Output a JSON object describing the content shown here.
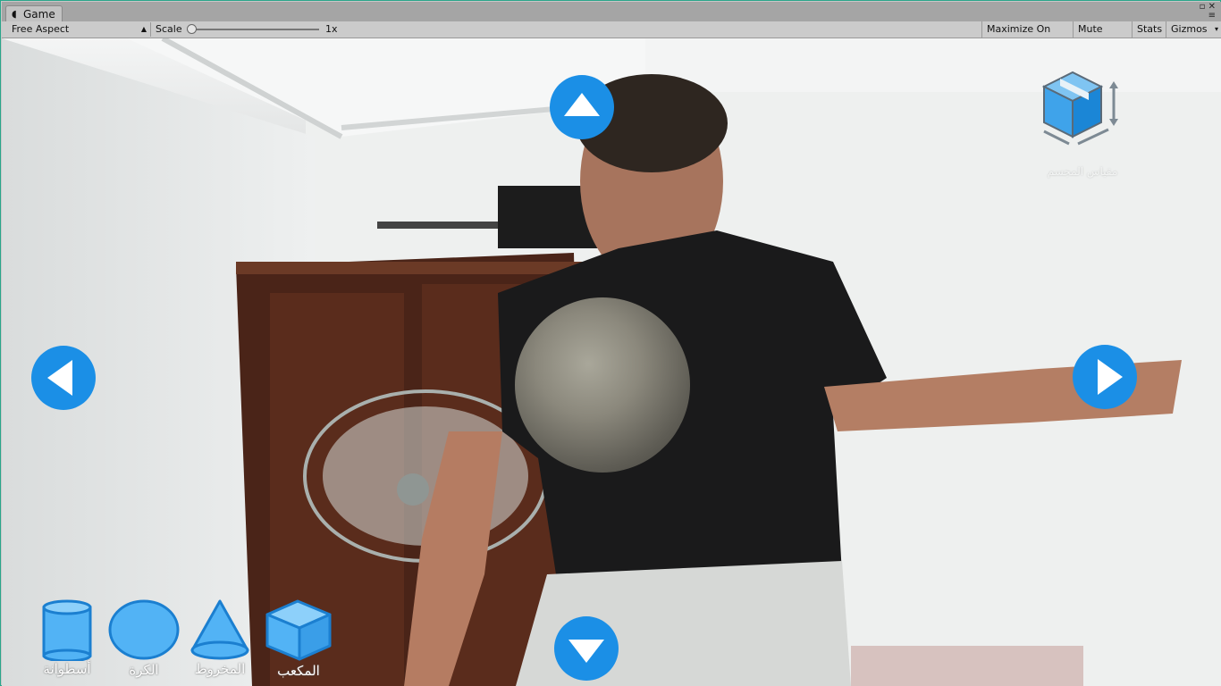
{
  "window": {
    "tab_title": "Game",
    "tab_icon": "game-icon"
  },
  "toolbar": {
    "aspect": "Free Aspect",
    "scale_label": "Scale",
    "scale_value": "1x",
    "scale_fraction": 0.02,
    "maximize_on_play": "Maximize On Play",
    "mute_audio": "Mute Audio",
    "stats": "Stats",
    "gizmos": "Gizmos"
  },
  "game": {
    "nav": {
      "up": "arrow-up-icon",
      "down": "arrow-down-icon",
      "left": "arrow-left-icon",
      "right": "arrow-right-icon"
    },
    "scale_tool": {
      "icon": "box-resize-icon",
      "label": "مقياس المجسم"
    },
    "shapes": [
      {
        "label": "أسطوانة",
        "icon": "cylinder-icon"
      },
      {
        "label": "الكرة",
        "icon": "sphere-icon"
      },
      {
        "label": "المخروط",
        "icon": "cone-icon"
      },
      {
        "label": "المكعب",
        "icon": "cube-icon"
      }
    ],
    "accent_color": "#1b8fe6",
    "shape_color": "#52b3f5"
  }
}
